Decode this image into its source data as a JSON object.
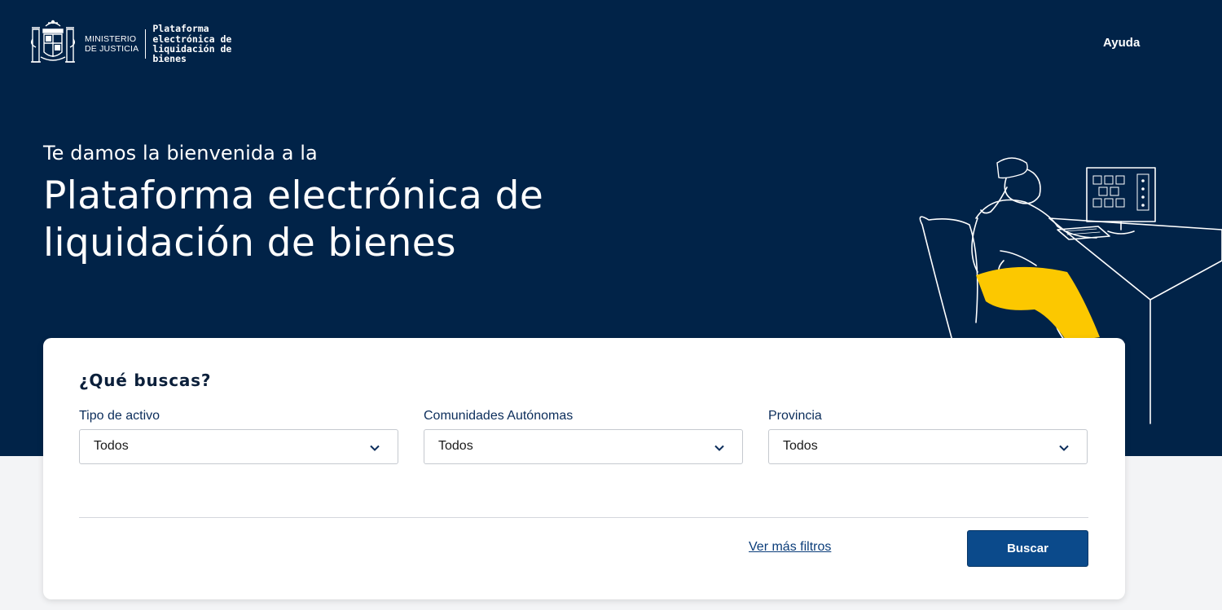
{
  "header": {
    "ministry_line1": "MINISTERIO",
    "ministry_line2": "DE JUSTICIA",
    "platform_lines": [
      "Plataforma",
      "electrónica de",
      "liquidación de",
      "bienes"
    ],
    "help_link": "Ayuda"
  },
  "hero": {
    "welcome": "Te damos la bienvenida a la",
    "title_line1": "Plataforma electrónica de",
    "title_line2": "liquidación de bienes"
  },
  "search": {
    "heading": "¿Qué buscas?",
    "fields": [
      {
        "label": "Tipo de activo",
        "value": "Todos"
      },
      {
        "label": "Comunidades Autónomas",
        "value": "Todos"
      },
      {
        "label": "Provincia",
        "value": "Todos"
      }
    ],
    "more_filters": "Ver más filtros",
    "submit": "Buscar"
  },
  "colors": {
    "hero_bg": "#012348",
    "primary_button": "#0b4a8b",
    "accent_yellow": "#fcc800"
  }
}
